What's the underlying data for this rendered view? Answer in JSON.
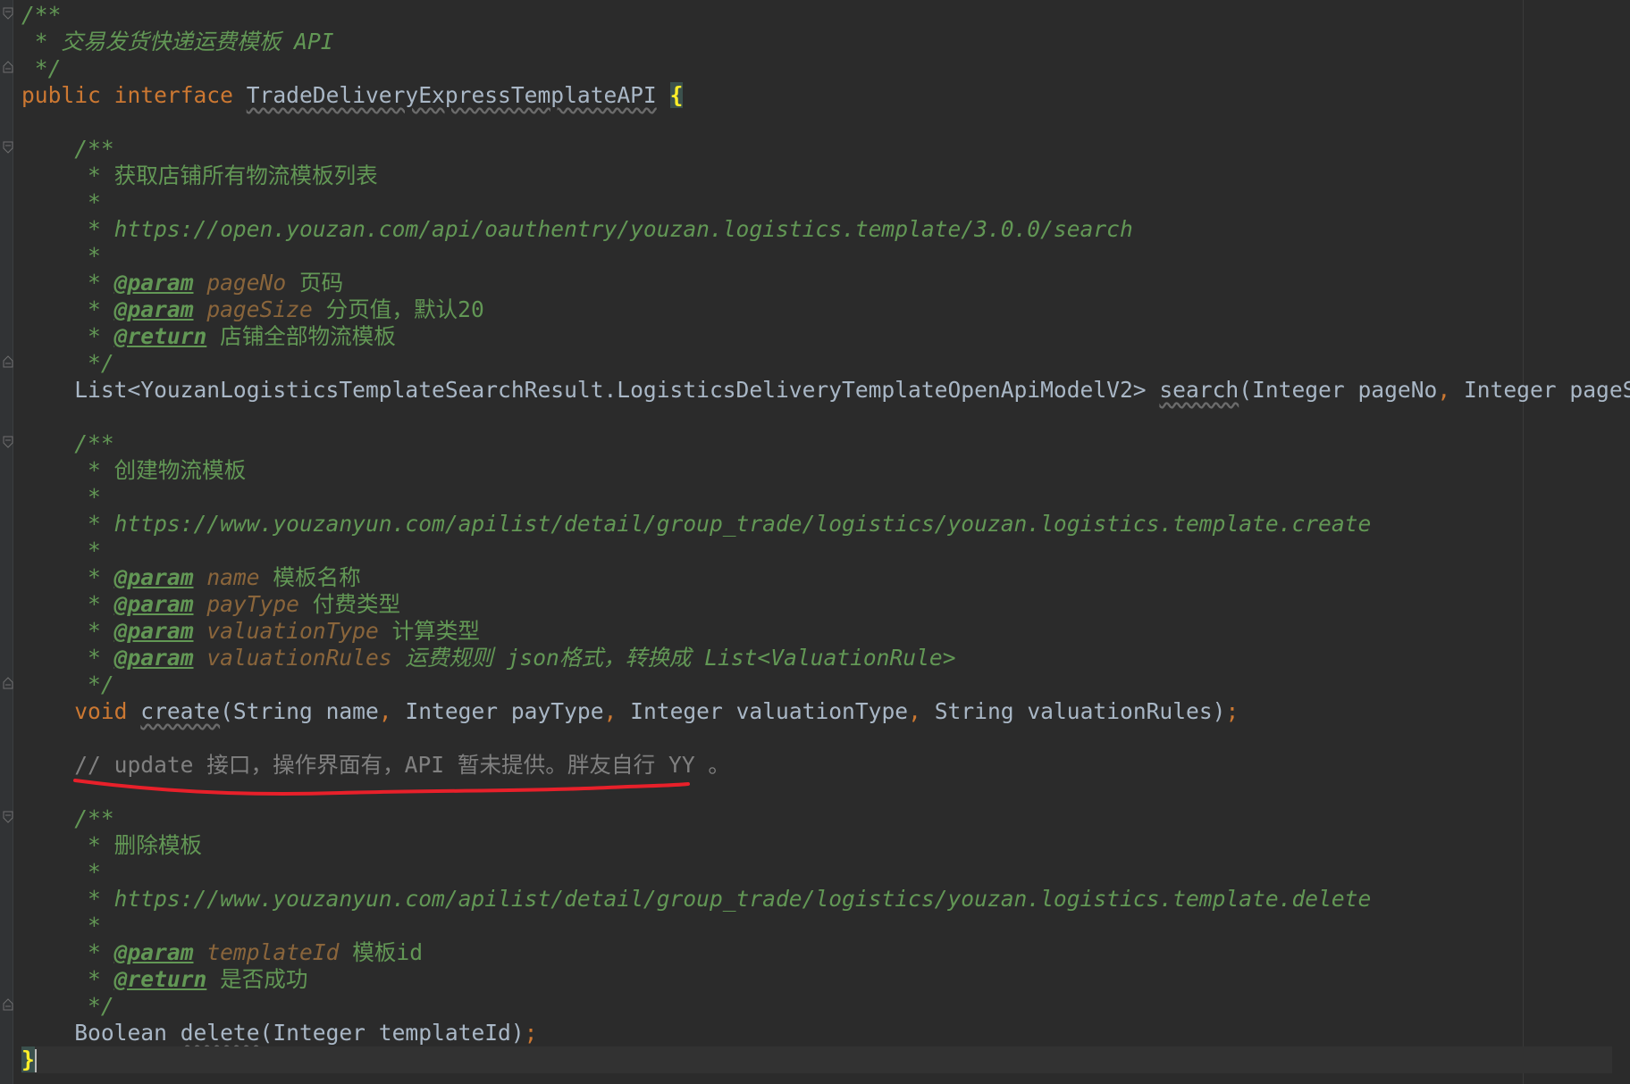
{
  "colors": {
    "background": "#2b2b2b",
    "keyword": "#cc7832",
    "doc_comment": "#629755",
    "param_name": "#8a653b",
    "identifier": "#a9b7c6",
    "line_comment": "#808080",
    "annotation_underline": "#e8202a"
  },
  "code": {
    "l01_a": "/**",
    "l02_a": " * 交易发货快递运费模板 API",
    "l03_a": " */",
    "l04_kw1": "public",
    "l04_kw2": "interface",
    "l04_name": "TradeDeliveryExpressTemplateAPI",
    "l04_brace": "{",
    "l06_a": "    /**",
    "l07_a": "     * 获取店铺所有物流模板列表",
    "l08_a": "     *",
    "l09_a": "     * https://open.youzan.com/api/oauthentry/youzan.logistics.template/3.0.0/search",
    "l10_a": "     *",
    "l11_star": "     * ",
    "l11_tag": "@param",
    "l11_p": "pageNo",
    "l11_d": " 页码",
    "l12_star": "     * ",
    "l12_tag": "@param",
    "l12_p": "pageSize",
    "l12_d": " 分页值，默认20",
    "l13_star": "     * ",
    "l13_tag": "@return",
    "l13_d": " 店铺全部物流模板",
    "l14_a": "     */",
    "l15_type": "    List<YouzanLogisticsTemplateSearchResult.LogisticsDeliveryTemplateOpenApiModelV2> ",
    "l15_method": "search",
    "l15_args1": "(Integer pageNo",
    "l15_comma": ",",
    "l15_args2": " Integer pageSize)",
    "l15_semi": ";",
    "l17_a": "    /**",
    "l18_a": "     * 创建物流模板",
    "l19_a": "     *",
    "l20_a": "     * https://www.youzanyun.com/apilist/detail/group_trade/logistics/youzan.logistics.template.create",
    "l21_a": "     *",
    "l22_star": "     * ",
    "l22_tag": "@param",
    "l22_p": "name",
    "l22_d": " 模板名称",
    "l23_star": "     * ",
    "l23_tag": "@param",
    "l23_p": "payType",
    "l23_d": " 付费类型",
    "l24_star": "     * ",
    "l24_tag": "@param",
    "l24_p": "valuationType",
    "l24_d": " 计算类型",
    "l25_star": "     * ",
    "l25_tag": "@param",
    "l25_p": "valuationRules",
    "l25_d": " 运费规则 json格式，转换成 List<ValuationRule>",
    "l26_a": "     */",
    "l27_kw": "    void ",
    "l27_method": "create",
    "l27_a1": "(String name",
    "l27_c1": ",",
    "l27_a2": " Integer payType",
    "l27_c2": ",",
    "l27_a3": " Integer valuationType",
    "l27_c3": ",",
    "l27_a4": " String valuationRules)",
    "l27_semi": ";",
    "l29_a": "    // update 接口，操作界面有，API 暂未提供。胖友自行 YY 。",
    "l31_a": "    /**",
    "l32_a": "     * 删除模板",
    "l33_a": "     *",
    "l34_a": "     * https://www.youzanyun.com/apilist/detail/group_trade/logistics/youzan.logistics.template.delete",
    "l35_a": "     *",
    "l36_star": "     * ",
    "l36_tag": "@param",
    "l36_p": "templateId",
    "l36_d": " 模板id",
    "l37_star": "     * ",
    "l37_tag": "@return",
    "l37_d": " 是否成功",
    "l38_a": "     */",
    "l39_type": "    Boolean ",
    "l39_method": "delete",
    "l39_args": "(Integer templateId)",
    "l39_semi": ";",
    "l40_brace": "}"
  }
}
